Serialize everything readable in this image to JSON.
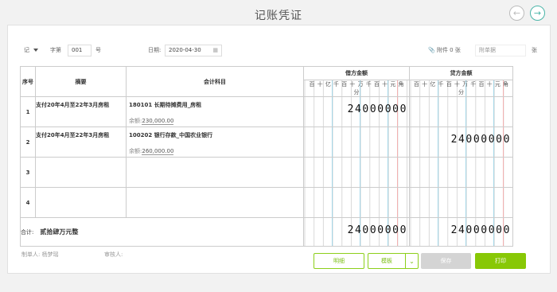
{
  "header": {
    "title": "记账凭证",
    "prev_icon": "arrow-left-icon",
    "next_icon": "arrow-right-icon"
  },
  "meta": {
    "voucher_word": "记",
    "word_label": "字第",
    "number": "001",
    "number_suffix": "号",
    "date_label": "日期:",
    "date": "2020-04-30",
    "attachment_label": "附件 0 张",
    "attachment_placeholder": "附单据",
    "attachment_unit": "张"
  },
  "table": {
    "headers": {
      "seq": "序号",
      "summary": "摘要",
      "account": "会计科目",
      "debit": "借方金额",
      "credit": "贷方金额"
    },
    "digit_units": [
      "百",
      "十",
      "亿",
      "千",
      "百",
      "十",
      "万",
      "千",
      "百",
      "十",
      "元",
      "角",
      "分"
    ],
    "rows": [
      {
        "seq": "1",
        "summary": "支付20年4月至22年3月房租",
        "account": "180101 长期待摊费用_房租",
        "balance_label": "余额:",
        "balance": "230,000.00",
        "debit": "24000000",
        "credit": ""
      },
      {
        "seq": "2",
        "summary": "支付20年4月至22年3月房租",
        "account": "100202 银行存款_中国农业银行",
        "balance_label": "余额:",
        "balance": "260,000.00",
        "debit": "",
        "credit": "24000000"
      },
      {
        "seq": "3",
        "summary": "",
        "account": "",
        "balance_label": "",
        "balance": "",
        "debit": "",
        "credit": ""
      },
      {
        "seq": "4",
        "summary": "",
        "account": "",
        "balance_label": "",
        "balance": "",
        "debit": "",
        "credit": ""
      }
    ],
    "total": {
      "label": "合计:",
      "amount_words": "贰拾肆万元整",
      "debit": "24000000",
      "credit": "24000000"
    }
  },
  "footer": {
    "maker_label": "制单人:",
    "maker": "杨梦瑶",
    "reviewer_label": "审核人:"
  },
  "buttons": {
    "detail": "明细",
    "template": "模板",
    "save": "保存",
    "print": "打印"
  },
  "colors": {
    "accent": "#88c806",
    "nav": "#4ab5a8"
  }
}
